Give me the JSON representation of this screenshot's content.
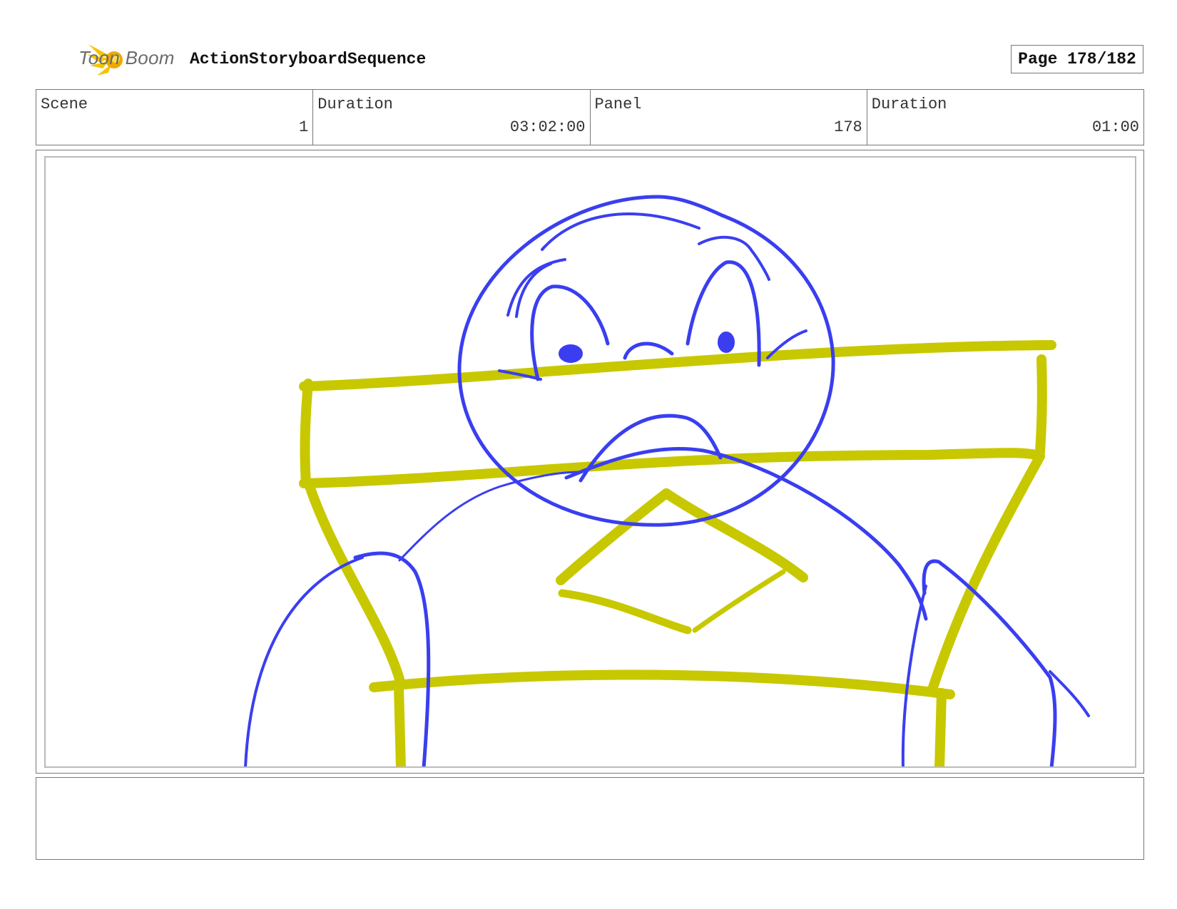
{
  "header": {
    "logo_text": "Toon Boom",
    "title": "ActionStoryboardSequence",
    "page_label": "Page 178/182"
  },
  "info": {
    "scene_label": "Scene",
    "scene_value": "1",
    "scene_duration_label": "Duration",
    "scene_duration_value": "03:02:00",
    "panel_label": "Panel",
    "panel_value": "178",
    "panel_duration_label": "Duration",
    "panel_duration_value": "01:00"
  },
  "drawing": {
    "rough_color": "#3a3ef0",
    "set_color": "#c8c800"
  },
  "notes": {
    "text": ""
  },
  "icons": {
    "logo": "toon-boom-star-icon"
  }
}
